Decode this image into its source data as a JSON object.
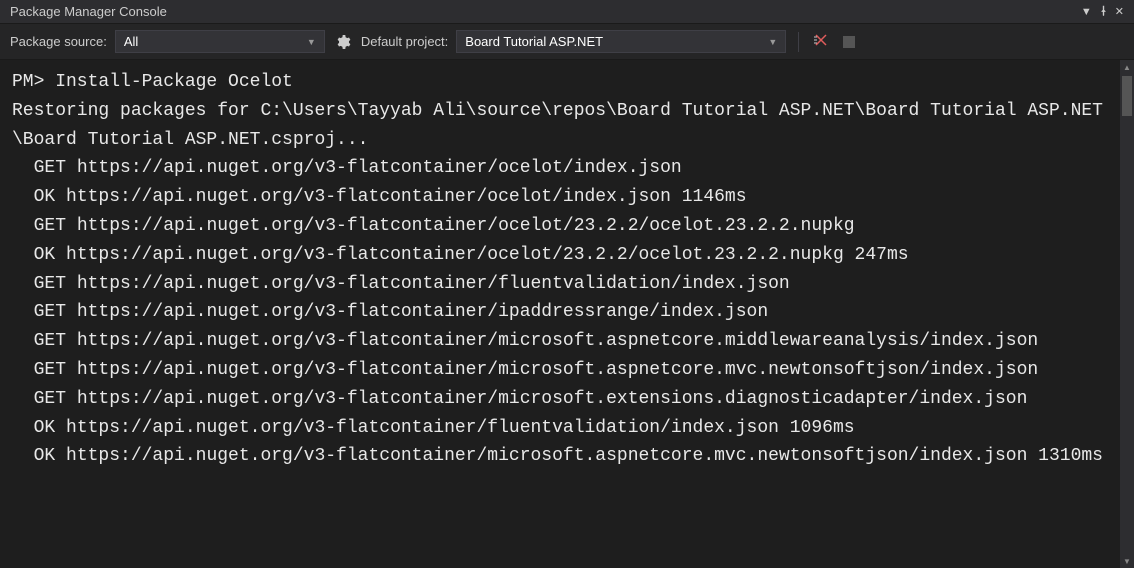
{
  "title_bar": {
    "title": "Package Manager Console"
  },
  "toolbar": {
    "package_source_label": "Package source:",
    "package_source_value": "All",
    "default_project_label": "Default project:",
    "default_project_value": "Board Tutorial ASP.NET"
  },
  "console": {
    "lines": [
      "PM> Install-Package Ocelot",
      "Restoring packages for C:\\Users\\Tayyab Ali\\source\\repos\\Board Tutorial ASP.NET\\Board Tutorial ASP.NET\\Board Tutorial ASP.NET.csproj...",
      "  GET https://api.nuget.org/v3-flatcontainer/ocelot/index.json",
      "  OK https://api.nuget.org/v3-flatcontainer/ocelot/index.json 1146ms",
      "  GET https://api.nuget.org/v3-flatcontainer/ocelot/23.2.2/ocelot.23.2.2.nupkg",
      "  OK https://api.nuget.org/v3-flatcontainer/ocelot/23.2.2/ocelot.23.2.2.nupkg 247ms",
      "  GET https://api.nuget.org/v3-flatcontainer/fluentvalidation/index.json",
      "  GET https://api.nuget.org/v3-flatcontainer/ipaddressrange/index.json",
      "  GET https://api.nuget.org/v3-flatcontainer/microsoft.aspnetcore.middlewareanalysis/index.json",
      "  GET https://api.nuget.org/v3-flatcontainer/microsoft.aspnetcore.mvc.newtonsoftjson/index.json",
      "  GET https://api.nuget.org/v3-flatcontainer/microsoft.extensions.diagnosticadapter/index.json",
      "  OK https://api.nuget.org/v3-flatcontainer/fluentvalidation/index.json 1096ms",
      "  OK https://api.nuget.org/v3-flatcontainer/microsoft.aspnetcore.mvc.newtonsoftjson/index.json 1310ms"
    ]
  }
}
